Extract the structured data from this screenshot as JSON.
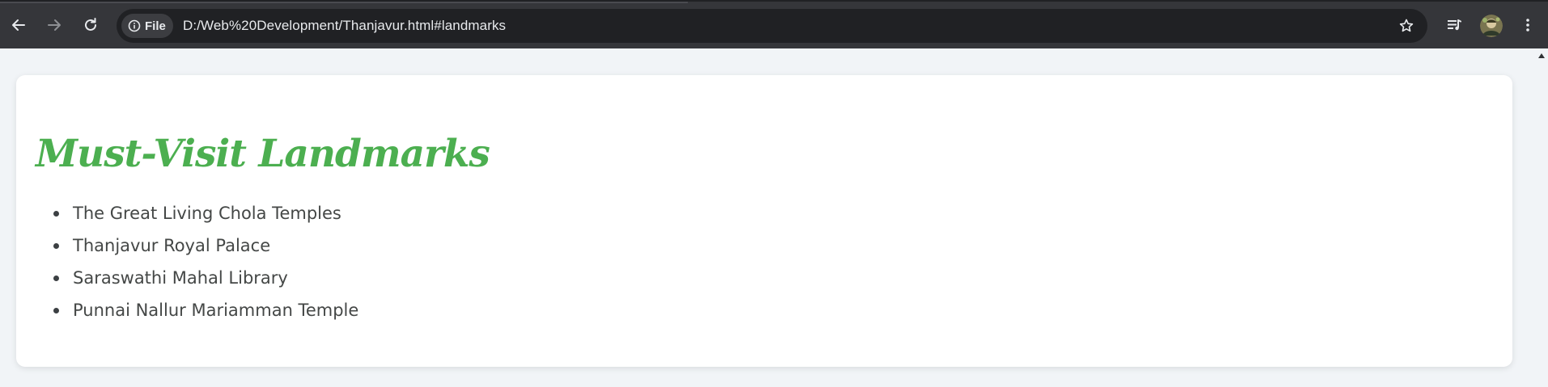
{
  "browser": {
    "site_chip_label": "File",
    "url": "D:/Web%20Development/Thanjavur.html#landmarks",
    "icons": {
      "back": "arrow-left-icon",
      "forward": "arrow-right-icon",
      "reload": "reload-icon",
      "site_info": "info-icon",
      "bookmark": "star-icon",
      "reading_list": "media-queue-icon",
      "profile": "avatar",
      "menu": "kebab-menu-icon"
    }
  },
  "page": {
    "title": "Must-Visit Landmarks",
    "landmarks": [
      "The Great Living Chola Temples",
      "Thanjavur Royal Palace",
      "Saraswathi Mahal Library",
      "Punnai Nallur Mariamman Temple"
    ]
  },
  "colors": {
    "title": "#4caf50",
    "page_background": "#f1f4f7",
    "card_background": "#ffffff",
    "chrome_background": "#35363a"
  }
}
